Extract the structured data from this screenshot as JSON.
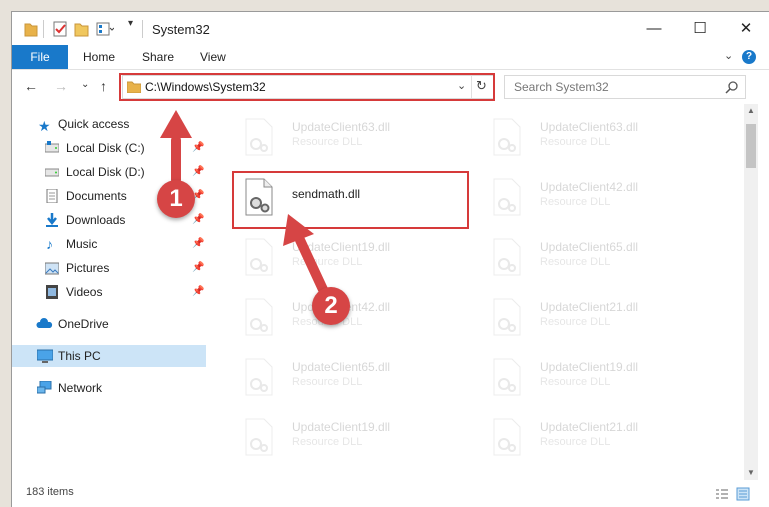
{
  "window": {
    "title": "System32",
    "controls": {
      "minimize": "—",
      "maximize": "☐",
      "close": "✕"
    }
  },
  "ribbon": {
    "file": "File",
    "tabs": [
      "Home",
      "Share",
      "View"
    ],
    "expand": "⌄",
    "help": "?"
  },
  "address": {
    "path": "C:\\Windows\\System32",
    "search_placeholder": "Search System32"
  },
  "nav_pane": {
    "quick_access": "Quick access",
    "items": [
      {
        "label": "Local Disk (C:)",
        "icon": "drive-icon",
        "pinned": true
      },
      {
        "label": "Local Disk (D:)",
        "icon": "drive-icon",
        "pinned": true
      },
      {
        "label": "Documents",
        "icon": "documents-icon",
        "pinned": true
      },
      {
        "label": "Downloads",
        "icon": "download-icon",
        "pinned": true
      },
      {
        "label": "Music",
        "icon": "music-icon",
        "pinned": true
      },
      {
        "label": "Pictures",
        "icon": "pictures-icon",
        "pinned": true
      },
      {
        "label": "Videos",
        "icon": "videos-icon",
        "pinned": true
      }
    ],
    "onedrive": "OneDrive",
    "this_pc": "This PC",
    "network": "Network"
  },
  "files": {
    "highlighted": {
      "name": "sendmath.dll",
      "type": ""
    },
    "left_column": [
      {
        "name": "UpdateClient63.dll",
        "type": "Resource DLL"
      },
      {
        "name": "UpdateClient19.dll",
        "type": "Resource DLL"
      },
      {
        "name": "UpdateClient42.dll",
        "type": "Resource DLL"
      },
      {
        "name": "UpdateClient65.dll",
        "type": "Resource DLL"
      },
      {
        "name": "UpdateClient19.dll",
        "type": "Resource DLL"
      }
    ],
    "right_column": [
      {
        "name": "UpdateClient63.dll",
        "type": "Resource DLL"
      },
      {
        "name": "UpdateClient42.dll",
        "type": "Resource DLL"
      },
      {
        "name": "UpdateClient65.dll",
        "type": "Resource DLL"
      },
      {
        "name": "UpdateClient21.dll",
        "type": "Resource DLL"
      },
      {
        "name": "UpdateClient19.dll",
        "type": "Resource DLL"
      },
      {
        "name": "UpdateClient21.dll",
        "type": "Resource DLL"
      }
    ]
  },
  "status": {
    "item_count": "183 items"
  },
  "annotations": {
    "step1": "1",
    "step2": "2"
  },
  "colors": {
    "accent": "#1979ca",
    "highlight": "#d63a3a",
    "selected": "#cce4f7"
  }
}
